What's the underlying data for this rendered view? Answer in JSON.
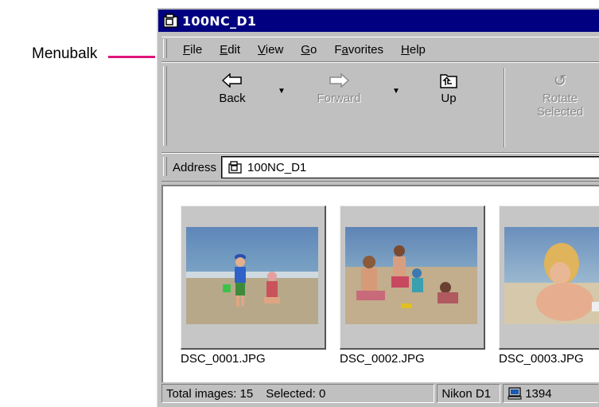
{
  "callout": {
    "label": "Menubalk",
    "line_color": "#e0157a"
  },
  "window": {
    "title": "100NC_D1",
    "title_bg": "#000080"
  },
  "menu": [
    {
      "accel": "F",
      "rest": "ile"
    },
    {
      "accel": "E",
      "rest": "dit"
    },
    {
      "accel": "V",
      "rest": "iew"
    },
    {
      "accel": "G",
      "rest": "o"
    },
    {
      "pre": "F",
      "accel": "a",
      "rest": "vorites"
    },
    {
      "accel": "H",
      "rest": "elp"
    }
  ],
  "toolbar": {
    "back": "Back",
    "forward": "Forward",
    "up": "Up",
    "rotate_line1": "Rotate",
    "rotate_line2": "Selected",
    "dropdown_glyph": "▼"
  },
  "address": {
    "label": "Address",
    "value": "100NC_D1"
  },
  "thumbnails": [
    {
      "filename": "DSC_0001.JPG"
    },
    {
      "filename": "DSC_0002.JPG"
    },
    {
      "filename": "DSC_0003.JPG"
    }
  ],
  "status": {
    "total": "Total images: 15",
    "selected": "Selected: 0",
    "camera": "Nikon D1",
    "port": "1394"
  },
  "icons": [
    "folder-camera-icon",
    "back-arrow-icon",
    "forward-arrow-icon",
    "up-folder-icon",
    "rotate-icon",
    "computer-icon"
  ]
}
